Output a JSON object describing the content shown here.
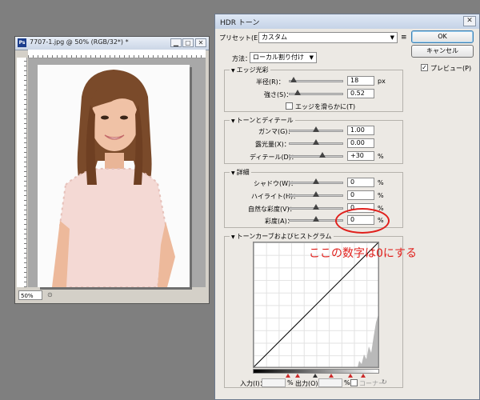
{
  "document": {
    "title": "7707-1.jpg @ 50% (RGB/32*) *",
    "app_icon": "Ps",
    "zoom": "50%"
  },
  "dialog": {
    "title": "HDR トーン",
    "close": "✕",
    "preset_label": "プリセット(E)：",
    "preset_value": "カスタム",
    "preset_menu_icon": "≡",
    "ok": "OK",
    "cancel": "キャンセル",
    "preview_label": "プレビュー(P)",
    "preview_checked": true,
    "method_label": "方法：",
    "method_value": "ローカル割り付け",
    "edge_glow": {
      "title": "エッジ光彩",
      "radius_label": "半径(R)：",
      "radius_value": "18",
      "radius_unit": "px",
      "strength_label": "強さ(S)：",
      "strength_value": "0.52",
      "smooth_label": "エッジを滑らかに(T)"
    },
    "tone_detail": {
      "title": "トーンとディテール",
      "gamma_label": "ガンマ(G)：",
      "gamma_value": "1.00",
      "exposure_label": "露光量(X)：",
      "exposure_value": "0.00",
      "detail_label": "ディテール(D)：",
      "detail_value": "+30",
      "detail_unit": "%"
    },
    "advanced": {
      "title": "詳細",
      "shadow_label": "シャドウ(W)：",
      "shadow_value": "0",
      "highlight_label": "ハイライト(H)：",
      "highlight_value": "0",
      "vibrance_label": "自然な彩度(V)：",
      "vibrance_value": "0",
      "saturation_label": "彩度(A)：",
      "saturation_value": "0",
      "unit": "%"
    },
    "curve": {
      "title": "トーンカーブおよびヒストグラム",
      "input_label": "入力(I)：",
      "output_label": "出力(O)：",
      "pct": "%",
      "corner_label": "コーナー"
    }
  },
  "annotation": {
    "text": "ここの数字は0にする",
    "color": "#e0201c"
  }
}
